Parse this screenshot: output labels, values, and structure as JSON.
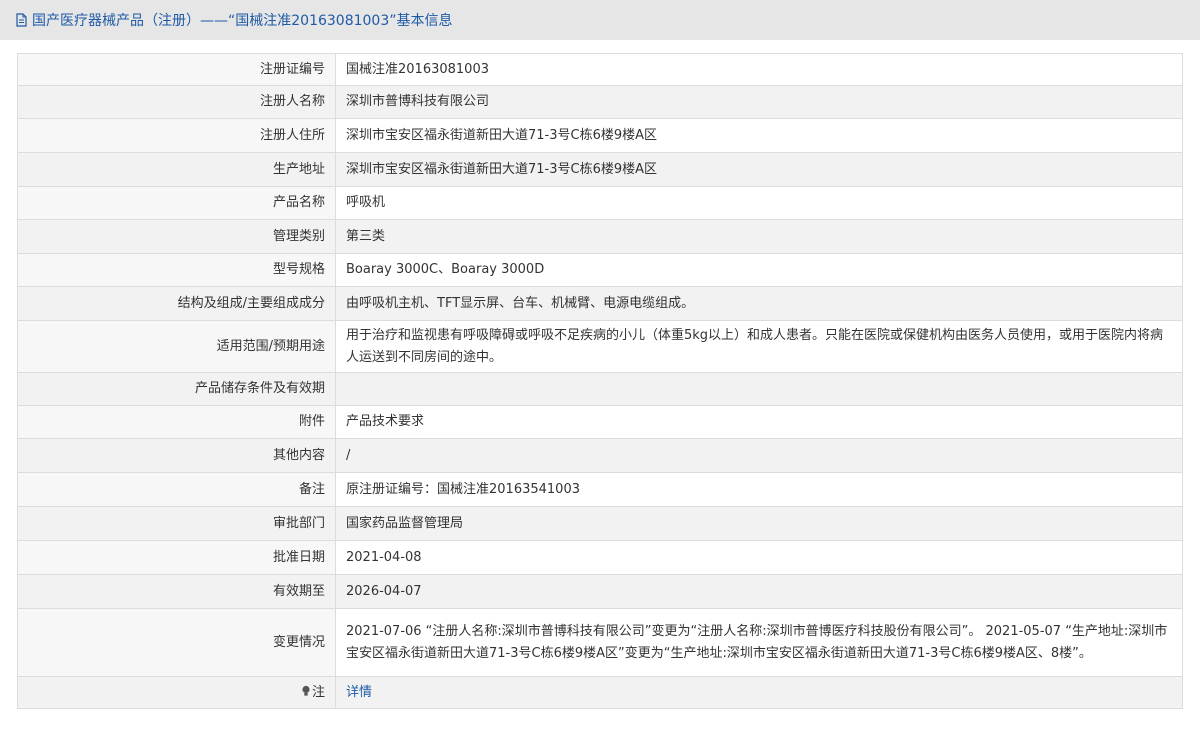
{
  "header": {
    "title": "国产医疗器械产品（注册）——“国械注准20163081003”基本信息"
  },
  "rows": [
    {
      "label": "注册证编号",
      "value": "国械注准20163081003"
    },
    {
      "label": "注册人名称",
      "value": "深圳市普博科技有限公司"
    },
    {
      "label": "注册人住所",
      "value": "深圳市宝安区福永街道新田大道71-3号C栋6楼9楼A区"
    },
    {
      "label": "生产地址",
      "value": "深圳市宝安区福永街道新田大道71-3号C栋6楼9楼A区"
    },
    {
      "label": "产品名称",
      "value": "呼吸机"
    },
    {
      "label": "管理类别",
      "value": "第三类"
    },
    {
      "label": "型号规格",
      "value": "Boaray 3000C、Boaray 3000D"
    },
    {
      "label": "结构及组成/主要组成成分",
      "value": "由呼吸机主机、TFT显示屏、台车、机械臂、电源电缆组成。"
    },
    {
      "label": "适用范围/预期用途",
      "value": "用于治疗和监视患有呼吸障碍或呼吸不足疾病的小儿（体重5kg以上）和成人患者。只能在医院或保健机构由医务人员使用，或用于医院内将病人运送到不同房间的途中。"
    },
    {
      "label": "产品储存条件及有效期",
      "value": ""
    },
    {
      "label": "附件",
      "value": "产品技术要求"
    },
    {
      "label": "其他内容",
      "value": "/"
    },
    {
      "label": "备注",
      "value": "原注册证编号：国械注准20163541003"
    },
    {
      "label": "审批部门",
      "value": "国家药品监督管理局"
    },
    {
      "label": "批准日期",
      "value": "2021-04-08"
    },
    {
      "label": "有效期至",
      "value": "2026-04-07"
    },
    {
      "label": "变更情况",
      "value": "2021-07-06 “注册人名称:深圳市普博科技有限公司”变更为“注册人名称:深圳市普博医疗科技股份有限公司”。 2021-05-07 “生产地址:深圳市宝安区福永街道新田大道71-3号C栋6楼9楼A区”变更为“生产地址:深圳市宝安区福永街道新田大道71-3号C栋6楼9楼A区、8楼”。"
    }
  ],
  "note_row": {
    "label": "注",
    "link": "详情"
  }
}
